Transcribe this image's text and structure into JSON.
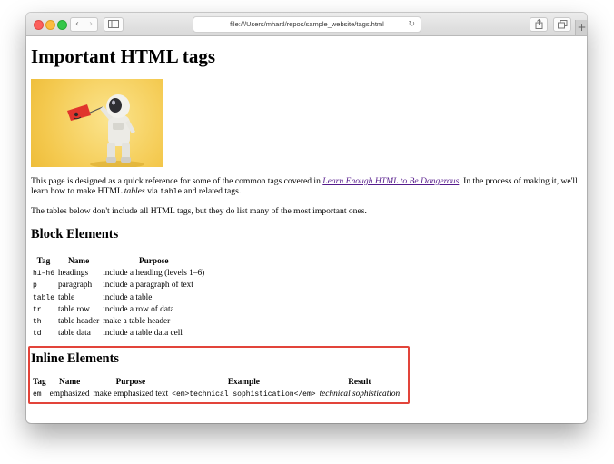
{
  "browser": {
    "address": "file:///Users/mhartl/repos/sample_website/tags.html",
    "back_glyph": "‹",
    "forward_glyph": "›",
    "reload_glyph": "↻",
    "new_tab_glyph": "+"
  },
  "page": {
    "title": "Important HTML tags",
    "hero_image": "illustration of an astronaut figurine holding a red flag on yellow background",
    "intro": {
      "before_link": "This page is designed as a quick reference for some of the common tags covered in ",
      "link_text": "Learn Enough HTML to Be Dangerous",
      "after_link": ". In the process of making it, we'll learn how to make HTML ",
      "em_word": "tables",
      "via_text": " via ",
      "code_word": "table",
      "end_text": " and related tags."
    },
    "note": "The tables below don't include all HTML tags, but they do list many of the most important ones."
  },
  "block_section": {
    "heading": "Block Elements",
    "headers": [
      "Tag",
      "Name",
      "Purpose"
    ],
    "rows": [
      {
        "tag": "h1–h6",
        "name": "headings",
        "purpose": "include a heading (levels 1–6)"
      },
      {
        "tag": "p",
        "name": "paragraph",
        "purpose": "include a paragraph of text"
      },
      {
        "tag": "table",
        "name": "table",
        "purpose": "include a table"
      },
      {
        "tag": "tr",
        "name": "table row",
        "purpose": "include a row of data"
      },
      {
        "tag": "th",
        "name": "table header",
        "purpose": "make a table header"
      },
      {
        "tag": "td",
        "name": "table data",
        "purpose": "include a table data cell"
      }
    ]
  },
  "inline_section": {
    "heading": "Inline Elements",
    "headers": [
      "Tag",
      "Name",
      "Purpose",
      "Example",
      "Result"
    ],
    "rows": [
      {
        "tag": "em",
        "name": "emphasized",
        "purpose": "make emphasized text",
        "example": "<em>technical sophistication</em>",
        "result": "technical sophistication"
      }
    ]
  },
  "colors": {
    "highlight_border": "#e2443a",
    "link": "#551a8b",
    "hero_bg": "#f4c94f"
  }
}
